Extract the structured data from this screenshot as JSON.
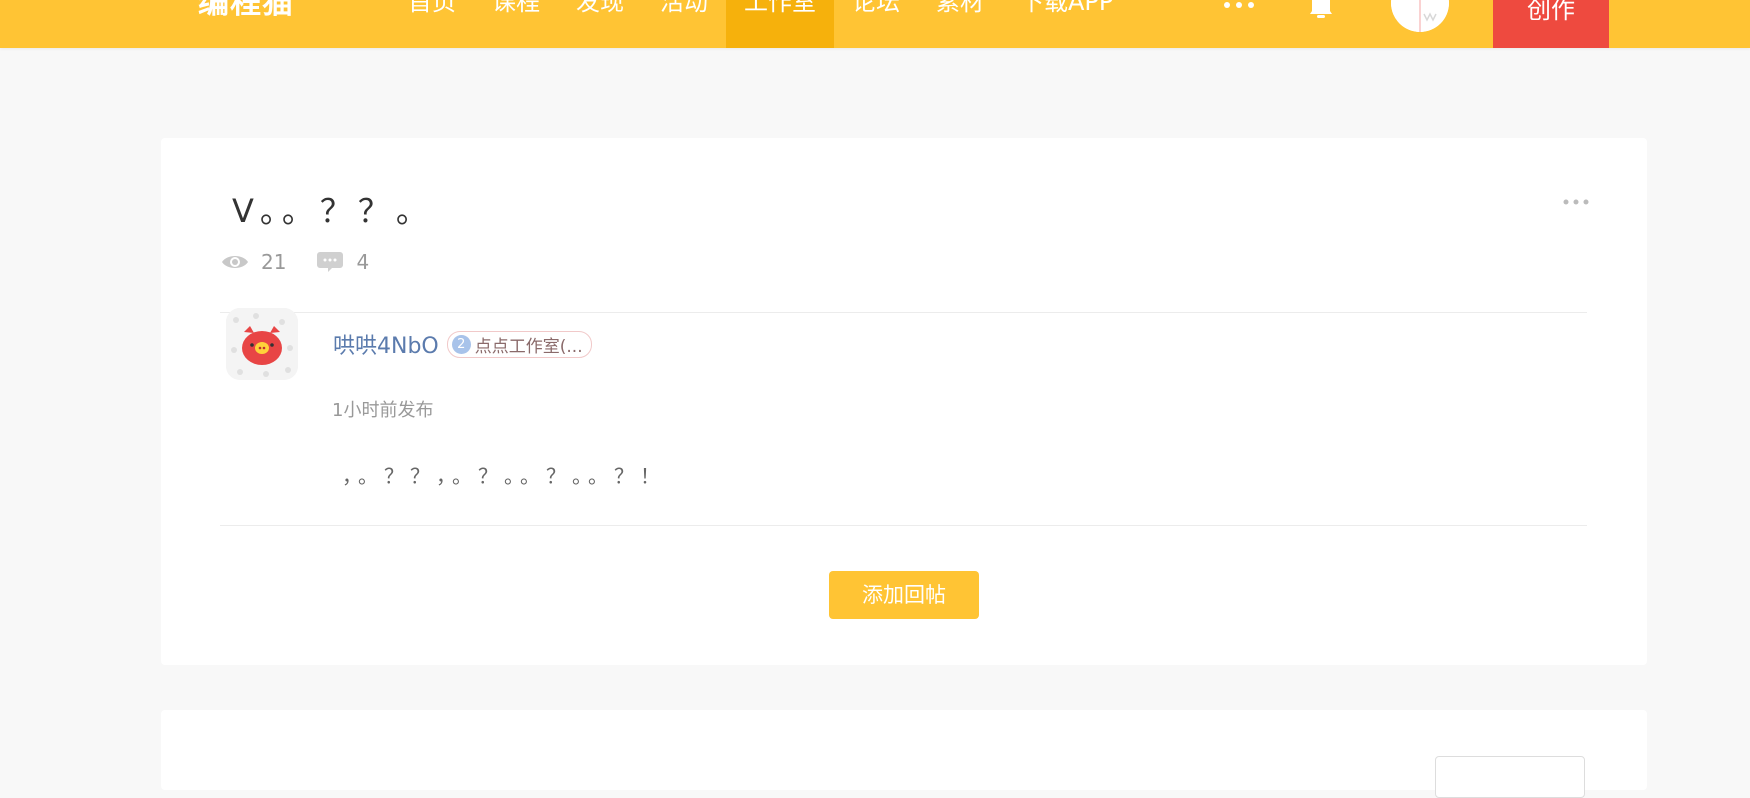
{
  "header": {
    "logo_text": "编程猫",
    "nav_items": [
      "首页",
      "课程",
      "发现",
      "活动",
      "工作室",
      "论坛",
      "素材",
      "下载APP"
    ],
    "active_nav": "工作室",
    "create_label": "创作",
    "accent_color": "#ffc434",
    "active_color": "#f6b10c",
    "create_color": "#ee4a3f"
  },
  "post": {
    "title": "V。。？？。",
    "views": "21",
    "comments": "4"
  },
  "reply": {
    "author": "哄哄4NbO",
    "badge_level": "2",
    "badge_text": "点点工作室(...",
    "time": "1小时前发布",
    "content": "，。？？，。？。。？。。？！"
  },
  "actions": {
    "add_reply": "添加回帖"
  },
  "icons": {
    "views": "eye-icon",
    "comments": "comment-icon",
    "more": "more-dots-icon",
    "notifications": "bell-icon"
  }
}
